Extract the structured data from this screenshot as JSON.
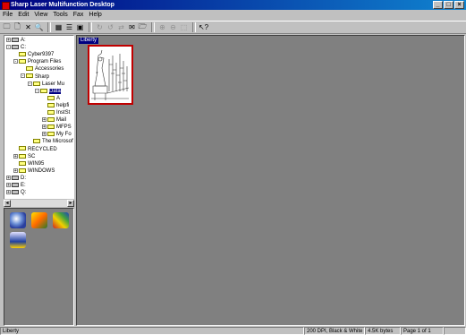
{
  "window": {
    "title": "Sharp Laser Multifunction Desktop"
  },
  "menu": [
    "File",
    "Edit",
    "View",
    "Tools",
    "Fax",
    "Help"
  ],
  "tree": {
    "items": [
      {
        "label": "A:",
        "type": "drive",
        "toggle": "+"
      },
      {
        "label": "C:",
        "type": "drive",
        "toggle": "-"
      },
      {
        "label": "Cyber9397",
        "type": "folder",
        "toggle": ""
      },
      {
        "label": "Program Files",
        "type": "folder",
        "toggle": "-"
      },
      {
        "label": "Accessories",
        "type": "folder",
        "toggle": ""
      },
      {
        "label": "Sharp",
        "type": "folder",
        "toggle": "-"
      },
      {
        "label": "Laser Mu",
        "type": "folder",
        "toggle": "-"
      },
      {
        "label": "Data",
        "type": "folder",
        "toggle": "-"
      },
      {
        "label": "A",
        "type": "folder",
        "toggle": ""
      },
      {
        "label": "helpfi",
        "type": "folder",
        "toggle": ""
      },
      {
        "label": "InstSt",
        "type": "folder",
        "toggle": ""
      },
      {
        "label": "Mail",
        "type": "folder",
        "toggle": "+"
      },
      {
        "label": "MFPS",
        "type": "folder",
        "toggle": "+"
      },
      {
        "label": "My Fo",
        "type": "folder",
        "toggle": "+"
      },
      {
        "label": "The Microsoft",
        "type": "folder",
        "toggle": ""
      },
      {
        "label": "RECYCLED",
        "type": "folder",
        "toggle": ""
      },
      {
        "label": "SC",
        "type": "folder",
        "toggle": "+"
      },
      {
        "label": "WIN95",
        "type": "folder",
        "toggle": ""
      },
      {
        "label": "WINDOWS",
        "type": "folder",
        "toggle": "+"
      },
      {
        "label": "D:",
        "type": "drive",
        "toggle": "+"
      },
      {
        "label": "E:",
        "type": "drive",
        "toggle": "+"
      },
      {
        "label": "Q:",
        "type": "drive",
        "toggle": "+"
      }
    ]
  },
  "thumbnail": {
    "label": "Liberty"
  },
  "status": {
    "left": "Liberty",
    "resolution": "200 DPI, Black & White",
    "size": "4.5K bytes",
    "page": "Page 1 of 1"
  },
  "colors": {
    "title_start": "#000080",
    "title_end": "#1084d0",
    "workspace": "#808080",
    "selection": "#c00000"
  }
}
